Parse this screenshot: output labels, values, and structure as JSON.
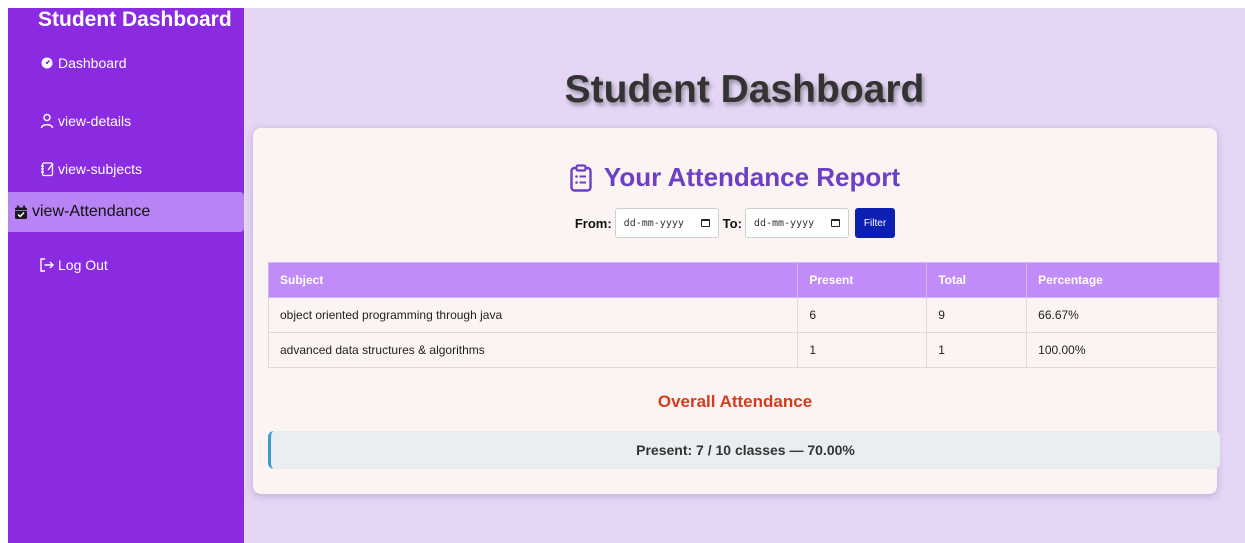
{
  "sidebar": {
    "brand": "Student Dashboard",
    "items": [
      {
        "label": "Dashboard",
        "icon": "dashboard-icon"
      },
      {
        "label": "view-details",
        "icon": "user-icon"
      },
      {
        "label": "view-subjects",
        "icon": "notebook-icon"
      },
      {
        "label": "view-Attendance",
        "icon": "calendar-check-icon",
        "active": true
      },
      {
        "label": "Log Out",
        "icon": "logout-icon"
      }
    ]
  },
  "main": {
    "title": "Student Dashboard",
    "report": {
      "title": "Your Attendance Report",
      "icon": "clipboard-list-icon",
      "filter": {
        "from_label": "From:",
        "from_value": "dd-mm-yyyy",
        "to_label": "To:",
        "to_value": "dd-mm-yyyy",
        "button_label": "Filter"
      },
      "table": {
        "headers": [
          "Subject",
          "Present",
          "Total",
          "Percentage"
        ],
        "rows": [
          [
            "object oriented programming through java",
            "6",
            "9",
            "66.67%"
          ],
          [
            "advanced data structures & algorithms",
            "1",
            "1",
            "100.00%"
          ]
        ]
      },
      "overall": {
        "title": "Overall Attendance",
        "summary": "Present: 7 / 10 classes — 70.00%"
      }
    }
  },
  "colors": {
    "sidebar": "#8a2be2",
    "sidebar_active": "#b883f5",
    "main_bg": "#e4d6f4",
    "accent": "#6d3fc4",
    "table_header": "#c18cf8",
    "filter_button": "#0b1fb3",
    "overall_title": "#d43b1f"
  }
}
